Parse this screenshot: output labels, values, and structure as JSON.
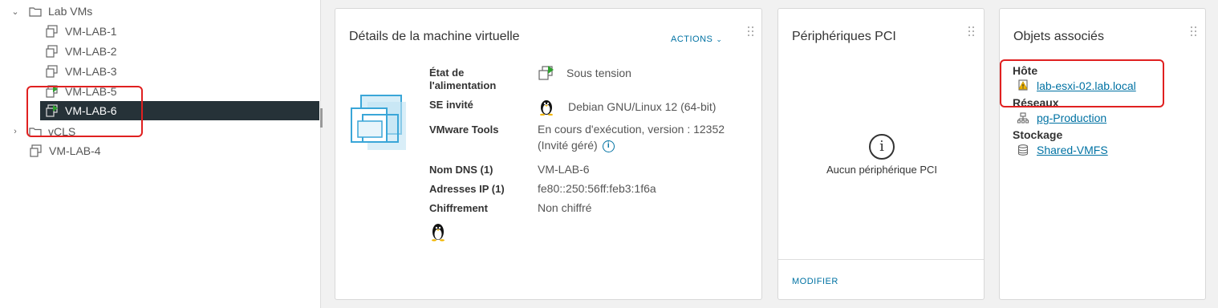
{
  "tree": {
    "folder_lab_vms": "Lab VMs",
    "items": [
      {
        "label": "VM-LAB-1",
        "state": "off"
      },
      {
        "label": "VM-LAB-2",
        "state": "off"
      },
      {
        "label": "VM-LAB-3",
        "state": "off"
      },
      {
        "label": "VM-LAB-5",
        "state": "on"
      },
      {
        "label": "VM-LAB-6",
        "state": "on",
        "selected": true
      }
    ],
    "folder_vcls": "vCLS",
    "vm_lab_4": "VM-LAB-4"
  },
  "vm_details": {
    "title": "Détails de la machine virtuelle",
    "actions_label": "ACTIONS",
    "power_label_1": "État de",
    "power_label_2": "l'alimentation",
    "power_value": "Sous tension",
    "guest_os_label": "SE invité",
    "guest_os_value": "Debian GNU/Linux 12 (64-bit)",
    "tools_label": "VMware Tools",
    "tools_value_1": "En cours d'exécution, version : 12352",
    "tools_value_2": "(Invité géré)",
    "dns_label": "Nom DNS (1)",
    "dns_value": "VM-LAB-6",
    "ip_label": "Adresses IP (1)",
    "ip_value": "fe80::250:56ff:feb3:1f6a",
    "enc_label": "Chiffrement",
    "enc_value": "Non chiffré"
  },
  "pci": {
    "title": "Périphériques PCI",
    "empty_text": "Aucun périphérique PCI",
    "modify_label": "MODIFIER"
  },
  "related": {
    "title": "Objets associés",
    "host_head": "Hôte",
    "host_link": "lab-esxi-02.lab.local",
    "networks_head": "Réseaux",
    "network_link": "pg-Production",
    "storage_head": "Stockage",
    "storage_link": "Shared-VMFS"
  },
  "colors": {
    "accent": "#0072a3",
    "selection": "#263238",
    "highlight": "#e02020",
    "power_on": "#2ea12e",
    "warning": "#f2b600"
  }
}
